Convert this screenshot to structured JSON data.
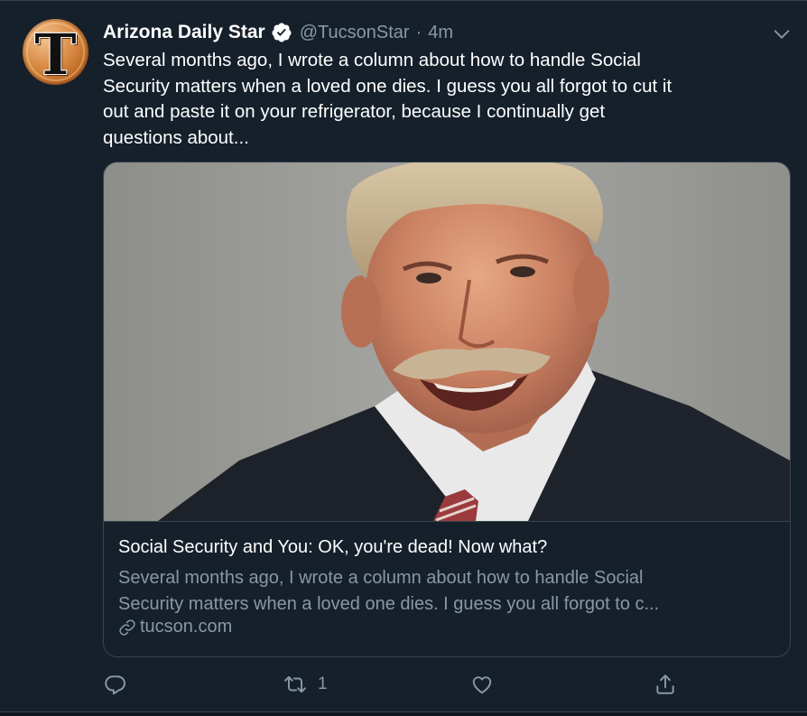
{
  "tweet": {
    "author_name": "Arizona Daily Star",
    "handle": "@TucsonStar",
    "separator": "·",
    "time": "4m",
    "avatar_letter": "T",
    "text_lines": [
      "Several months ago, I wrote a column about how to handle Social",
      "Security matters when a loved one dies. I guess you all forgot to cut it",
      "out and paste it on your refrigerator, because I continually get",
      "questions about..."
    ],
    "verified": true
  },
  "card": {
    "title": "Social Security and You: OK, you're dead! Now what?",
    "description_lines": [
      "Several months ago, I wrote a column about how to handle Social",
      "Security matters when a loved one dies. I guess you all forgot to c..."
    ],
    "domain": "tucson.com"
  },
  "actions": {
    "reply_count": "",
    "retweet_count": "1",
    "like_count": "",
    "share_label": ""
  },
  "colors": {
    "background": "#15202b",
    "border": "#38444d",
    "secondary_text": "#8899a6",
    "verified_badge": "#ffffff"
  },
  "icons": [
    "verified-badge-icon",
    "chevron-down-icon",
    "link-icon",
    "reply-icon",
    "retweet-icon",
    "like-icon",
    "share-icon"
  ]
}
